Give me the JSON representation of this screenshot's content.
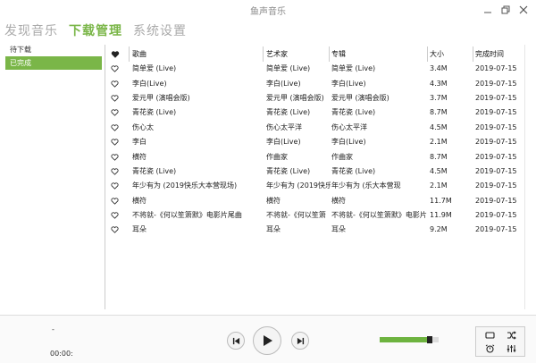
{
  "window": {
    "title": "鱼声音乐"
  },
  "tabs": [
    {
      "label": "发现音乐",
      "active": false
    },
    {
      "label": "下载管理",
      "active": true
    },
    {
      "label": "系统设置",
      "active": false
    }
  ],
  "sidebar": {
    "items": [
      {
        "label": "待下载",
        "active": false
      },
      {
        "label": "已完成",
        "active": true
      }
    ]
  },
  "table": {
    "columns": {
      "song": "歌曲",
      "artist": "艺术家",
      "album": "专辑",
      "size": "大小",
      "date": "完成时间"
    },
    "rows": [
      {
        "song": "简单爱 (Live)",
        "artist": "简单爱 (Live)",
        "album": "简单爱 (Live)",
        "size": "3.4M",
        "date": "2019-07-15"
      },
      {
        "song": "李白(Live)",
        "artist": "李白(Live)",
        "album": "李白(Live)",
        "size": "4.3M",
        "date": "2019-07-15"
      },
      {
        "song": "爱元甲 (演唱会版)",
        "artist": "爱元甲 (演唱会版)",
        "album": "爱元甲 (演唱会版)",
        "size": "3.7M",
        "date": "2019-07-15"
      },
      {
        "song": "青花瓷 (Live)",
        "artist": "青花瓷 (Live)",
        "album": "青花瓷 (Live)",
        "size": "8.7M",
        "date": "2019-07-15"
      },
      {
        "song": "伤心太",
        "artist": "伤心太平洋",
        "album": "伤心太平洋",
        "size": "4.5M",
        "date": "2019-07-15"
      },
      {
        "song": "李白",
        "artist": "李白(Live)",
        "album": "李白(Live)",
        "size": "2.1M",
        "date": "2019-07-15"
      },
      {
        "song": "横符",
        "artist": "作曲家",
        "album": "作曲家",
        "size": "8.7M",
        "date": "2019-07-15"
      },
      {
        "song": "青花瓷 (Live)",
        "artist": "青花瓷 (Live)",
        "album": "青花瓷 (Live)",
        "size": "4.5M",
        "date": "2019-07-15"
      },
      {
        "song": "年少有为 (2019快乐大本营现场)",
        "artist": "年少有为 (2019快乐",
        "album": "年少有为 (乐大本营现",
        "size": "2.1M",
        "date": "2019-07-15"
      },
      {
        "song": "横符",
        "artist": "横符",
        "album": "横符",
        "size": "11.7M",
        "date": "2019-07-15"
      },
      {
        "song": "不将就-《何以笙箫默》电影片尾曲",
        "artist": "不将就-《何以笙箫",
        "album": "不将就-《何以笙箫默》电影片",
        "size": "11.9M",
        "date": "2019-07-15"
      },
      {
        "song": "耳朵",
        "artist": "耳朵",
        "album": "耳朵",
        "size": "9.2M",
        "date": "2019-07-15"
      }
    ]
  },
  "player": {
    "track_title": "-",
    "time": "00:00:",
    "volume": 0.85
  },
  "colors": {
    "accent": "#7ab648",
    "volume": "#6db33f"
  },
  "icons": {
    "window": [
      "minimize-icon",
      "restore-icon",
      "close-icon"
    ],
    "controls": [
      "previous-icon",
      "play-icon",
      "next-icon"
    ],
    "extras": [
      "loop-icon",
      "shuffle-icon",
      "alarm-icon",
      "equalizer-icon"
    ],
    "favorite": "heart-icon"
  }
}
